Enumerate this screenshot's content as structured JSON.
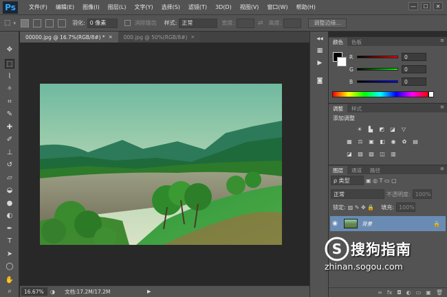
{
  "app": {
    "logo": "Ps"
  },
  "menu": [
    "文件(F)",
    "编辑(E)",
    "图像(I)",
    "图层(L)",
    "文字(Y)",
    "选择(S)",
    "滤镜(T)",
    "3D(D)",
    "视图(V)",
    "窗口(W)",
    "帮助(H)"
  ],
  "window_buttons": [
    "—",
    "☐",
    "✕"
  ],
  "options": {
    "feather_label": "羽化:",
    "feather_value": "0 像素",
    "antialias_label": "消除锯齿",
    "style_label": "样式:",
    "style_value": "正常",
    "width_label": "宽度:",
    "height_label": "高度:",
    "refine_edge_label": "调整边缘..."
  },
  "tabs": [
    {
      "label": "00000.jpg @ 16.7%(RGB/8#) *"
    },
    {
      "label": "000.jpg @ 50%(RGB/8#)"
    }
  ],
  "tab_close": "×",
  "status": {
    "zoom": "16.67%",
    "doc": "文档:17.2M/17.2M",
    "arrow": "▶"
  },
  "panels": {
    "color": {
      "tabs": [
        "颜色",
        "色板"
      ],
      "sliders": [
        {
          "label": "R",
          "value": "0"
        },
        {
          "label": "G",
          "value": "0"
        },
        {
          "label": "B",
          "value": "0"
        }
      ]
    },
    "adjust": {
      "tabs": [
        "调整",
        "样式"
      ],
      "title": "添加调整"
    },
    "layers": {
      "tabs": [
        "图层",
        "通道",
        "路径"
      ],
      "kind": "ρ 类型",
      "blend": "正常",
      "opacity_label": "不透明度:",
      "opacity_value": "100%",
      "lock_label": "锁定:",
      "fill_label": "填充:",
      "fill_value": "100%",
      "layer_name": "背景"
    }
  },
  "watermark": {
    "cn": "搜狗指南",
    "url": "zhinan.sogou.com"
  },
  "colors": {
    "accent": "#31a8ff",
    "panel": "#535353",
    "canvas": "#282828",
    "selected_layer": "#6a8cb4"
  }
}
